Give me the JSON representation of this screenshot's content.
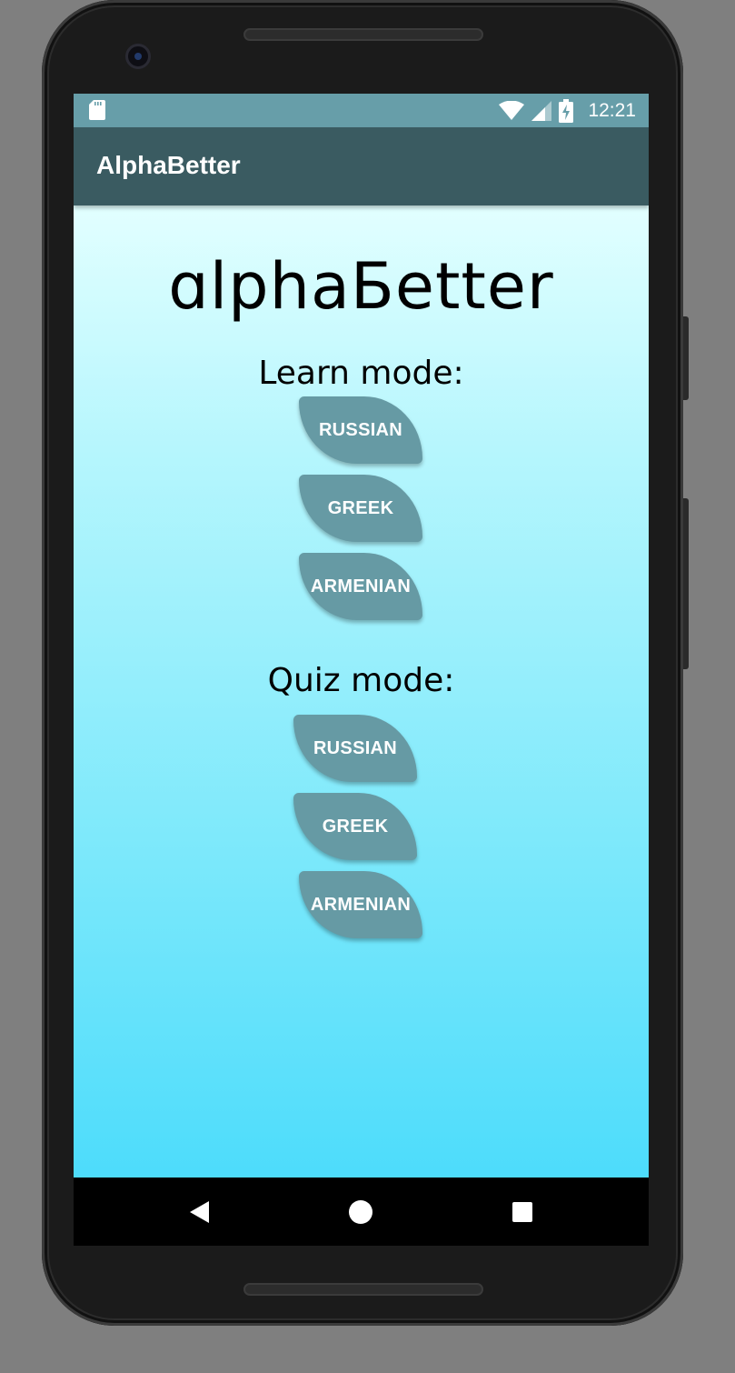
{
  "status_bar": {
    "time": "12:21",
    "icons": [
      "sd-card-icon",
      "wifi-icon",
      "cell-signal-icon",
      "battery-charging-icon"
    ]
  },
  "app_bar": {
    "title": "AlphaBetter"
  },
  "main": {
    "logo": "ɑlphaБetter",
    "learn_mode": {
      "label": "Learn mode:",
      "buttons": [
        "RUSSIAN",
        "GREEK",
        "ARMENIAN"
      ]
    },
    "quiz_mode": {
      "label": "Quiz mode:",
      "buttons": [
        "RUSSIAN",
        "GREEK",
        "ARMENIAN"
      ]
    }
  },
  "nav_bar": {
    "buttons": [
      "back-icon",
      "home-icon",
      "recents-icon"
    ]
  },
  "colors": {
    "status_bar": "#679ea9",
    "app_bar": "#3a5b61",
    "button": "#669aa4",
    "gradient_top": "#e2ffff",
    "gradient_bottom": "#4ddcfb"
  }
}
